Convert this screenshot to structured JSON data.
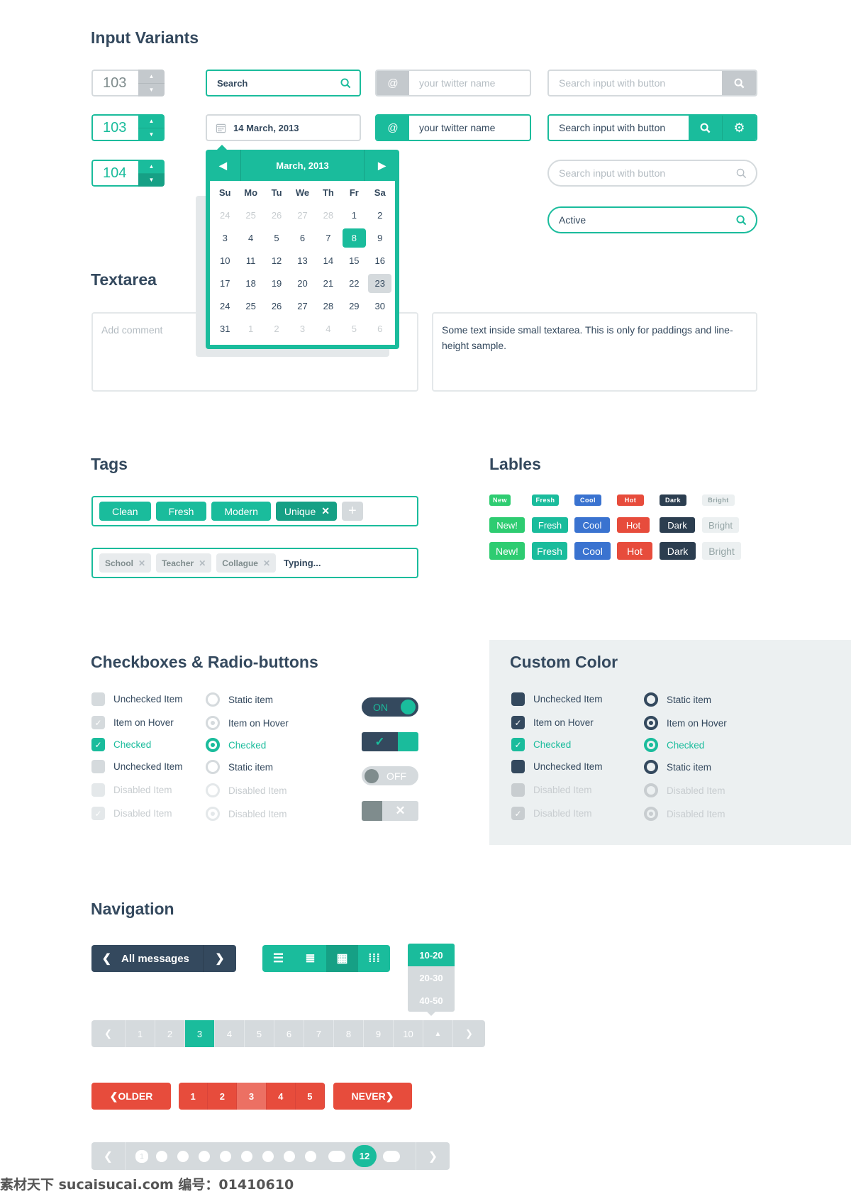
{
  "sections": {
    "inputs": "Input Variants",
    "textarea": "Textarea",
    "tags": "Tags",
    "labels": "Lables",
    "checkboxes": "Checkboxes & Radio-buttons",
    "custom": "Custom Color",
    "navigation": "Navigation"
  },
  "colors": {
    "teal": "#1abc9c",
    "teal_dark": "#16a085",
    "dark": "#34495e",
    "gray": "#d5dadd",
    "red": "#e74c3c",
    "blue": "#3a73d0",
    "green": "#2ecc71"
  },
  "steppers": [
    {
      "value": "103",
      "state": "default"
    },
    {
      "value": "103",
      "state": "focus"
    },
    {
      "value": "104",
      "state": "active"
    }
  ],
  "search": {
    "value": "Search",
    "icon": "search-icon"
  },
  "date": {
    "value": "14 March, 2013",
    "icon": "calendar-icon"
  },
  "twitter": {
    "prefix": "@",
    "placeholder": "your twitter name",
    "value": "your twitter name"
  },
  "search_button": {
    "placeholder": "Search input with button",
    "value": "Search input with button",
    "rounded_placeholder": "Search input with button",
    "active_value": "Active"
  },
  "calendar": {
    "title": "March, 2013",
    "weekdays": [
      "Su",
      "Mo",
      "Tu",
      "We",
      "Th",
      "Fr",
      "Sa"
    ],
    "weeks": [
      [
        {
          "d": "24",
          "other": true
        },
        {
          "d": "25",
          "other": true
        },
        {
          "d": "26",
          "other": true
        },
        {
          "d": "27",
          "other": true
        },
        {
          "d": "28",
          "other": true
        },
        {
          "d": "1"
        },
        {
          "d": "2"
        }
      ],
      [
        {
          "d": "3"
        },
        {
          "d": "4"
        },
        {
          "d": "5"
        },
        {
          "d": "6"
        },
        {
          "d": "7"
        },
        {
          "d": "8"
        },
        {
          "d": "9"
        }
      ],
      [
        {
          "d": "10"
        },
        {
          "d": "11"
        },
        {
          "d": "12"
        },
        {
          "d": "13"
        },
        {
          "d": "14"
        },
        {
          "d": "15"
        },
        {
          "d": "16"
        }
      ],
      [
        {
          "d": "17"
        },
        {
          "d": "18"
        },
        {
          "d": "19"
        },
        {
          "d": "20"
        },
        {
          "d": "21"
        },
        {
          "d": "22"
        },
        {
          "d": "23"
        }
      ],
      [
        {
          "d": "24"
        },
        {
          "d": "25"
        },
        {
          "d": "26"
        },
        {
          "d": "27"
        },
        {
          "d": "28"
        },
        {
          "d": "29"
        },
        {
          "d": "30"
        }
      ],
      [
        {
          "d": "31"
        },
        {
          "d": "1",
          "other": true
        },
        {
          "d": "2",
          "other": true
        },
        {
          "d": "3",
          "other": true
        },
        {
          "d": "4",
          "other": true
        },
        {
          "d": "5",
          "other": true
        },
        {
          "d": "6",
          "other": true
        }
      ]
    ],
    "selected": "8",
    "highlighted": "23"
  },
  "textarea": {
    "placeholder": "Add comment",
    "value": "Some text inside small textarea. This is only for paddings and line-height sample."
  },
  "tags": {
    "group1": [
      {
        "label": "Clean"
      },
      {
        "label": "Fresh"
      },
      {
        "label": "Modern"
      },
      {
        "label": "Unique",
        "removable": true
      }
    ],
    "group2": [
      "School",
      "Teacher",
      "Collague"
    ],
    "typing": "Typing..."
  },
  "labels": {
    "rows": [
      [
        "New",
        "Fresh",
        "Cool",
        "Hot",
        "Dark",
        "Bright"
      ],
      [
        "New!",
        "Fresh",
        "Cool",
        "Hot",
        "Dark",
        "Bright"
      ],
      [
        "New!",
        "Fresh",
        "Cool",
        "Hot",
        "Dark",
        "Bright"
      ]
    ],
    "colors": [
      "#2ecc71",
      "#1abc9c",
      "#3a73d0",
      "#e74c3c",
      "#2c3e50",
      "#ecf0f1"
    ]
  },
  "checkboxes": [
    {
      "label": "Unchecked Item",
      "state": "unchecked"
    },
    {
      "label": "Item on Hover",
      "state": "hover"
    },
    {
      "label": "Checked",
      "state": "checked"
    },
    {
      "label": "Unchecked Item",
      "state": "unchecked"
    },
    {
      "label": "Disabled Item",
      "state": "disabled"
    },
    {
      "label": "Disabled Item",
      "state": "disabled-checked"
    }
  ],
  "radios": [
    {
      "label": "Static item",
      "state": "unchecked"
    },
    {
      "label": "Item on Hover",
      "state": "hover"
    },
    {
      "label": "Checked",
      "state": "checked"
    },
    {
      "label": "Static item",
      "state": "unchecked"
    },
    {
      "label": "Disabled Item",
      "state": "disabled"
    },
    {
      "label": "Disabled Item",
      "state": "disabled-checked"
    }
  ],
  "toggles": {
    "on": "ON",
    "off": "OFF"
  },
  "nav": {
    "all_messages": "All messages",
    "view_modes": [
      "list-thick-icon",
      "list-icon",
      "tiles-icon",
      "grid-icon"
    ],
    "view_active": 2,
    "dropdown": [
      "10-20",
      "20-30",
      "40-50"
    ],
    "dropdown_selected": "10-20",
    "pages": [
      "1",
      "2",
      "3",
      "4",
      "5",
      "6",
      "7",
      "8",
      "9",
      "10"
    ],
    "current_page": "3",
    "red": {
      "older": "OLDER",
      "pages": [
        "1",
        "2",
        "3",
        "4",
        "5"
      ],
      "current": "3",
      "never": "NEVER"
    },
    "dots": {
      "first": "1",
      "current": "12"
    }
  },
  "watermark": "素材天下 sucaisucai.com  编号：01410610"
}
